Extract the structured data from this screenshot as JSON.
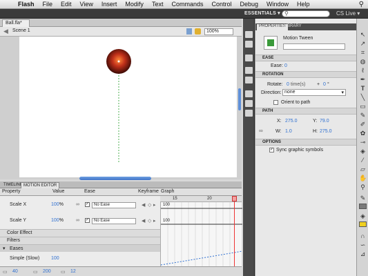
{
  "menubar": {
    "apple": "",
    "items": [
      "Flash",
      "File",
      "Edit",
      "View",
      "Insert",
      "Modify",
      "Text",
      "Commands",
      "Control",
      "Debug",
      "Window",
      "Help"
    ]
  },
  "appbar": {
    "workspace": "ESSENTIALS ▾",
    "search_placeholder": "",
    "cslive": "CS Live ▾"
  },
  "document": {
    "tab": "Ball.fla*",
    "scene": "Scene 1",
    "zoom": "100%"
  },
  "motion_editor": {
    "tabs": [
      "TIMELINE",
      "MOTION EDITOR"
    ],
    "columns": [
      "Property",
      "Value",
      "Ease",
      "Keyframe",
      "Graph"
    ],
    "graph_ticks": [
      "15",
      "20"
    ],
    "rows": [
      {
        "prop": "Scale X",
        "value": "100",
        "unit": "%",
        "ease": "No Ease",
        "graph_value": "100"
      },
      {
        "prop": "Scale Y",
        "value": "100",
        "unit": "%",
        "ease": "No Ease",
        "graph_value": "100"
      }
    ],
    "sections": [
      "Color Effect",
      "Filters",
      "Eases"
    ],
    "ease_row": {
      "prop": "Simple (Slow)",
      "value": "100"
    },
    "footer": [
      "40",
      "200",
      "12"
    ]
  },
  "properties": {
    "tabs": [
      "PROPERTIES",
      "LIBRARY"
    ],
    "instance_type": "Motion Tween",
    "ease": {
      "header": "EASE",
      "label": "Ease:",
      "value": "0"
    },
    "rotation": {
      "header": "ROTATION",
      "rotate_label": "Rotate:",
      "times": "0",
      "times_unit": "time(s)",
      "plus": "+",
      "degrees": "0",
      "deg_unit": "°",
      "direction_label": "Direction:",
      "direction_value": "none",
      "orient": "Orient to path"
    },
    "path": {
      "header": "PATH",
      "x_label": "X:",
      "x": "275.0",
      "y_label": "Y:",
      "y": "79.0",
      "w_label": "W:",
      "w": "1.0",
      "h_label": "H:",
      "h": "275.0"
    },
    "options": {
      "header": "OPTIONS",
      "sync": "Sync graphic symbols"
    }
  },
  "colors": {
    "accent_link": "#2e6fd0",
    "playhead": "#e33333",
    "ball": "#8b1a0a",
    "path": "#4caf50"
  }
}
